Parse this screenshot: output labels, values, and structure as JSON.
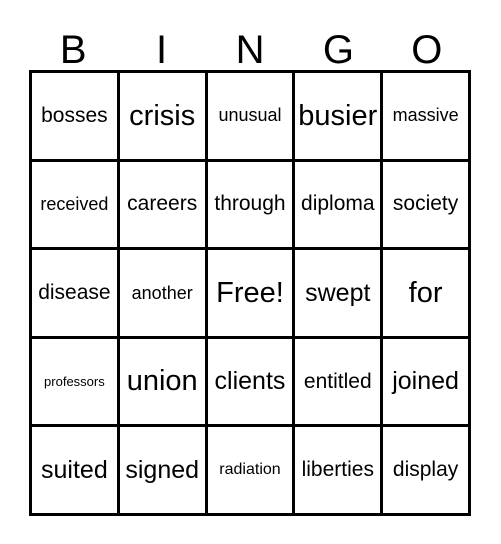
{
  "card": {
    "headers": [
      "B",
      "I",
      "N",
      "G",
      "O"
    ],
    "rows": [
      [
        {
          "text": "bosses",
          "size": "fs-l"
        },
        {
          "text": "crisis",
          "size": "fs-xxl"
        },
        {
          "text": "unusual",
          "size": "fs-m"
        },
        {
          "text": "busier",
          "size": "fs-xxl"
        },
        {
          "text": "massive",
          "size": "fs-m"
        }
      ],
      [
        {
          "text": "received",
          "size": "fs-m"
        },
        {
          "text": "careers",
          "size": "fs-l"
        },
        {
          "text": "through",
          "size": "fs-l"
        },
        {
          "text": "diploma",
          "size": "fs-l"
        },
        {
          "text": "society",
          "size": "fs-l"
        }
      ],
      [
        {
          "text": "disease",
          "size": "fs-l"
        },
        {
          "text": "another",
          "size": "fs-m"
        },
        {
          "text": "Free!",
          "size": "fs-xxl"
        },
        {
          "text": "swept",
          "size": "fs-xl"
        },
        {
          "text": "for",
          "size": "fs-xxl"
        }
      ],
      [
        {
          "text": "professors",
          "size": "fs-xs"
        },
        {
          "text": "union",
          "size": "fs-xxl"
        },
        {
          "text": "clients",
          "size": "fs-xl"
        },
        {
          "text": "entitled",
          "size": "fs-l"
        },
        {
          "text": "joined",
          "size": "fs-xl"
        }
      ],
      [
        {
          "text": "suited",
          "size": "fs-xl"
        },
        {
          "text": "signed",
          "size": "fs-xl"
        },
        {
          "text": "radiation",
          "size": "fs-s"
        },
        {
          "text": "liberties",
          "size": "fs-l"
        },
        {
          "text": "display",
          "size": "fs-l"
        }
      ]
    ]
  },
  "colors": {
    "border": "#000000",
    "background": "#ffffff",
    "text": "#000000"
  }
}
